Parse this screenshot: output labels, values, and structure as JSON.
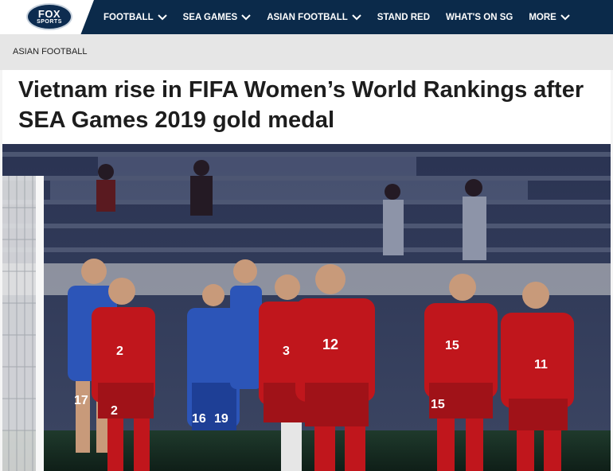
{
  "brand": {
    "logo_line1": "FOX",
    "logo_line2": "SPORTS"
  },
  "nav": {
    "items": [
      {
        "label": "FOOTBALL",
        "has_dropdown": true
      },
      {
        "label": "SEA GAMES",
        "has_dropdown": true
      },
      {
        "label": "ASIAN FOOTBALL",
        "has_dropdown": true
      },
      {
        "label": "STAND RED",
        "has_dropdown": false
      },
      {
        "label": "WHAT'S ON SG",
        "has_dropdown": false
      },
      {
        "label": "MORE",
        "has_dropdown": true
      }
    ]
  },
  "breadcrumb": {
    "label": "ASIAN FOOTBALL"
  },
  "article": {
    "title": "Vietnam rise in FIFA Women’s World Rankings after SEA Games 2019 gold medal"
  },
  "photo": {
    "jersey_numbers": [
      "2",
      "3",
      "12",
      "15",
      "11",
      "17",
      "16",
      "19",
      "2",
      "15"
    ]
  },
  "colors": {
    "nav_bg": "#0b2a4a",
    "vietnam_red": "#c0161c",
    "thailand_blue": "#2c55b8"
  }
}
